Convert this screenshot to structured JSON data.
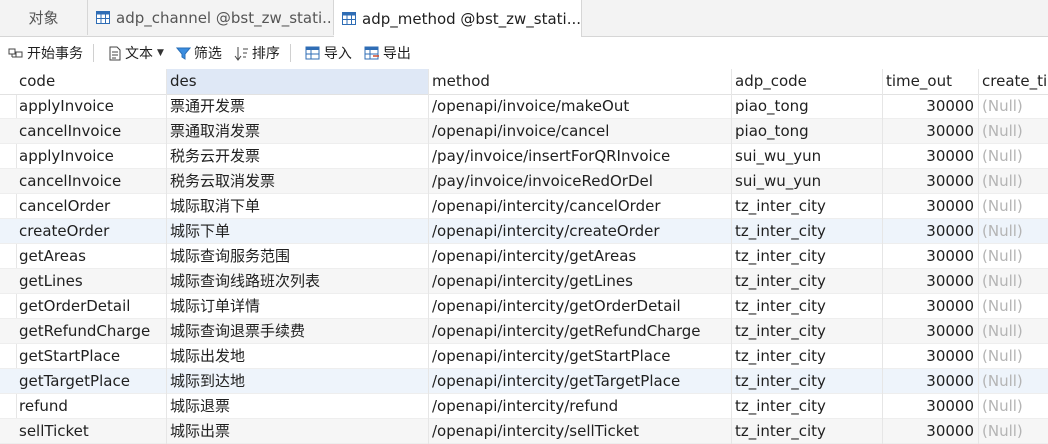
{
  "tabs": [
    {
      "label": "对象",
      "active": false
    },
    {
      "label": "adp_channel @bst_zw_stati...",
      "active": false
    },
    {
      "label": "adp_method @bst_zw_stati...",
      "active": true
    }
  ],
  "toolbar": {
    "begin_transaction": "开始事务",
    "text": "文本",
    "filter": "筛选",
    "sort": "排序",
    "import": "导入",
    "export": "导出"
  },
  "grid": {
    "columns": [
      "code",
      "des",
      "method",
      "adp_code",
      "time_out",
      "create_tir"
    ],
    "rows": [
      {
        "code": "applyInvoice",
        "des": "票通开发票",
        "method": "/openapi/invoice/makeOut",
        "adp_code": "piao_tong",
        "time_out": "30000",
        "create": "(Null)"
      },
      {
        "code": "cancelInvoice",
        "des": "票通取消发票",
        "method": "/openapi/invoice/cancel",
        "adp_code": "piao_tong",
        "time_out": "30000",
        "create": "(Null)"
      },
      {
        "code": "applyInvoice",
        "des": "税务云开发票",
        "method": "/pay/invoice/insertForQRInvoice",
        "adp_code": "sui_wu_yun",
        "time_out": "30000",
        "create": "(Null)"
      },
      {
        "code": "cancelInvoice",
        "des": "税务云取消发票",
        "method": "/pay/invoice/invoiceRedOrDel",
        "adp_code": "sui_wu_yun",
        "time_out": "30000",
        "create": "(Null)"
      },
      {
        "code": "cancelOrder",
        "des": "城际取消下单",
        "method": "/openapi/intercity/cancelOrder",
        "adp_code": "tz_inter_city",
        "time_out": "30000",
        "create": "(Null)"
      },
      {
        "code": "createOrder",
        "des": "城际下单",
        "method": "/openapi/intercity/createOrder",
        "adp_code": "tz_inter_city",
        "time_out": "30000",
        "create": "(Null)"
      },
      {
        "code": "getAreas",
        "des": "城际查询服务范围",
        "method": "/openapi/intercity/getAreas",
        "adp_code": "tz_inter_city",
        "time_out": "30000",
        "create": "(Null)"
      },
      {
        "code": "getLines",
        "des": "城际查询线路班次列表",
        "method": "/openapi/intercity/getLines",
        "adp_code": "tz_inter_city",
        "time_out": "30000",
        "create": "(Null)"
      },
      {
        "code": "getOrderDetail",
        "des": "城际订单详情",
        "method": "/openapi/intercity/getOrderDetail",
        "adp_code": "tz_inter_city",
        "time_out": "30000",
        "create": "(Null)"
      },
      {
        "code": "getRefundCharge",
        "des": "城际查询退票手续费",
        "method": "/openapi/intercity/getRefundCharge",
        "adp_code": "tz_inter_city",
        "time_out": "30000",
        "create": "(Null)"
      },
      {
        "code": "getStartPlace",
        "des": "城际出发地",
        "method": "/openapi/intercity/getStartPlace",
        "adp_code": "tz_inter_city",
        "time_out": "30000",
        "create": "(Null)"
      },
      {
        "code": "getTargetPlace",
        "des": "城际到达地",
        "method": "/openapi/intercity/getTargetPlace",
        "adp_code": "tz_inter_city",
        "time_out": "30000",
        "create": "(Null)"
      },
      {
        "code": "refund",
        "des": "城际退票",
        "method": "/openapi/intercity/refund",
        "adp_code": "tz_inter_city",
        "time_out": "30000",
        "create": "(Null)"
      },
      {
        "code": "sellTicket",
        "des": "城际出票",
        "method": "/openapi/intercity/sellTicket",
        "adp_code": "tz_inter_city",
        "time_out": "30000",
        "create": "(Null)"
      }
    ]
  },
  "colors": {
    "selected_header": "#dfe8f6",
    "null_text": "#b4b4b4",
    "grid_icon": "#2f6db5"
  }
}
